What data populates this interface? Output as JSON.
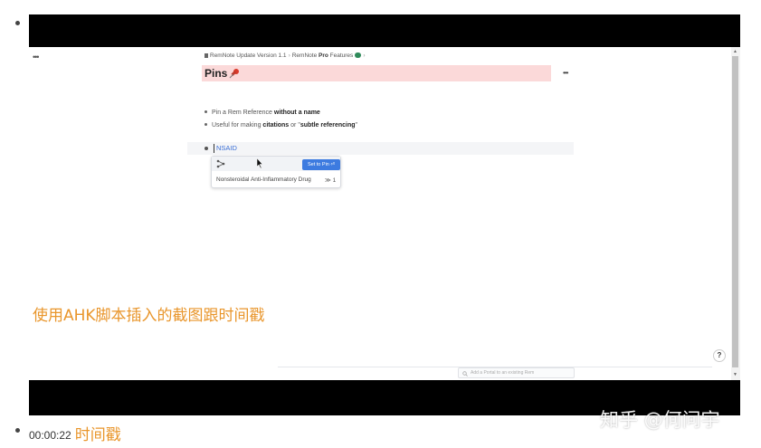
{
  "screen": {
    "top_menu": "•••",
    "breadcrumb": {
      "root": "RemNote Update Version 1.1",
      "sep1": "›",
      "parent_pre": "RemNote ",
      "parent_bold": "Pro",
      "parent_post": " Features",
      "sep2": "›"
    },
    "title": "Pins",
    "title_menu": "•••",
    "bullets": [
      {
        "pre": "Pin a Rem Reference ",
        "bold": "without a name",
        "post": ""
      },
      {
        "pre": "Useful for making ",
        "bold": "citations",
        "mid": " or \"",
        "bold2": "subtle referencing",
        "post": "\""
      }
    ],
    "active_rem": "NSAID",
    "popup": {
      "set_pin_label": "Set to Pin ⏎",
      "item_label": "Nonsteroidal Anti-Inflammatory Drug",
      "item_count": "≫ 1"
    },
    "help_label": "?",
    "search_placeholder": "Add a Portal to an existing Rem"
  },
  "overlay_caption": "使用AHK脚本插入的截图跟时间戳",
  "timestamp": {
    "time": "00:00:22",
    "label": "时间戳"
  },
  "watermark": "知乎 @何问宇",
  "colors": {
    "accent_orange": "#e9962c",
    "title_highlight": "#fbd9d9",
    "button_blue": "#3d7be0",
    "link_blue": "#3b6fd6"
  }
}
